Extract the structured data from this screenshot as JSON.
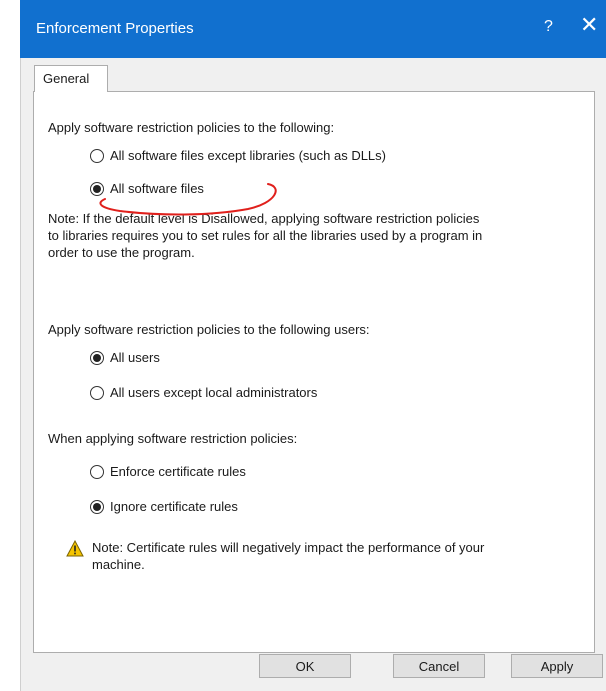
{
  "window": {
    "title": "Enforcement Properties",
    "help_label": "?",
    "close_label": "✕"
  },
  "tabs": [
    {
      "label": "General",
      "active": true
    }
  ],
  "section1": {
    "heading": "Apply software restriction policies to the following:",
    "options": [
      {
        "label": "All software files except libraries (such as DLLs)",
        "selected": false
      },
      {
        "label": "All software files",
        "selected": true
      }
    ],
    "note_lines": [
      "Note:  If the default level is Disallowed, applying software restriction policies",
      "to libraries requires you to set rules for all the libraries used by a program in",
      "order to use the program."
    ]
  },
  "section2": {
    "heading": "Apply software restriction policies to the following users:",
    "options": [
      {
        "label": "All users",
        "selected": true
      },
      {
        "label": "All users except local administrators",
        "selected": false
      }
    ]
  },
  "section3": {
    "heading": "When applying software restriction policies:",
    "options": [
      {
        "label": "Enforce certificate rules",
        "selected": false
      },
      {
        "label": "Ignore certificate rules",
        "selected": true
      }
    ],
    "warning_lines": [
      "Note:  Certificate rules will negatively impact the performance of your",
      "machine."
    ]
  },
  "buttons": {
    "ok": "OK",
    "cancel": "Cancel",
    "apply": "Apply"
  },
  "icons": {
    "warning": "warning-icon",
    "annotation": "red-underline-annotation"
  },
  "colors": {
    "titlebar": "#1170cf",
    "annotation": "#e0201c",
    "warning": "#f5c400"
  }
}
